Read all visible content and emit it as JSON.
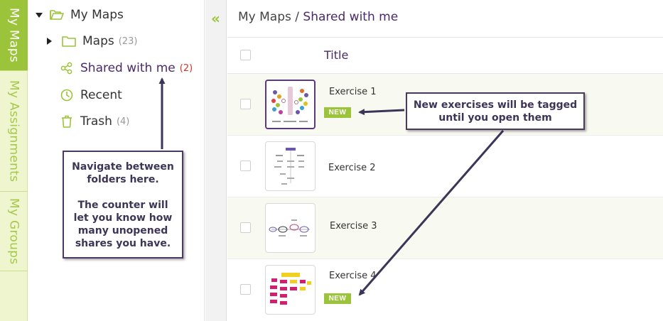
{
  "tabs": [
    {
      "label": "My Maps",
      "active": true
    },
    {
      "label": "My Assignments",
      "active": false
    },
    {
      "label": "My Groups",
      "active": false
    }
  ],
  "tree": {
    "root": "My Maps",
    "maps": {
      "label": "Maps",
      "count": "(23)"
    },
    "shared": {
      "label": "Shared with me",
      "count": "(2)"
    },
    "recent": {
      "label": "Recent"
    },
    "trash": {
      "label": "Trash",
      "count": "(4)"
    }
  },
  "collapse_glyph": "«",
  "breadcrumb": {
    "root": "My Maps",
    "separator": " / ",
    "current": "Shared with me"
  },
  "table": {
    "title_header": "Title"
  },
  "exercises": [
    {
      "name": "Exercise 1",
      "badge": "NEW"
    },
    {
      "name": "Exercise 2"
    },
    {
      "name": "Exercise 3"
    },
    {
      "name": "Exercise 4",
      "badge": "NEW"
    }
  ],
  "callouts": {
    "nav": "Navigate between folders here.\n\nThe counter will let you know how many unopened shares you have.",
    "new": "New exercises will be tagged until you open them"
  },
  "colors": {
    "accent_green": "#9cc43a",
    "purple": "#4a2a6a",
    "counter_red": "#d0342c"
  }
}
